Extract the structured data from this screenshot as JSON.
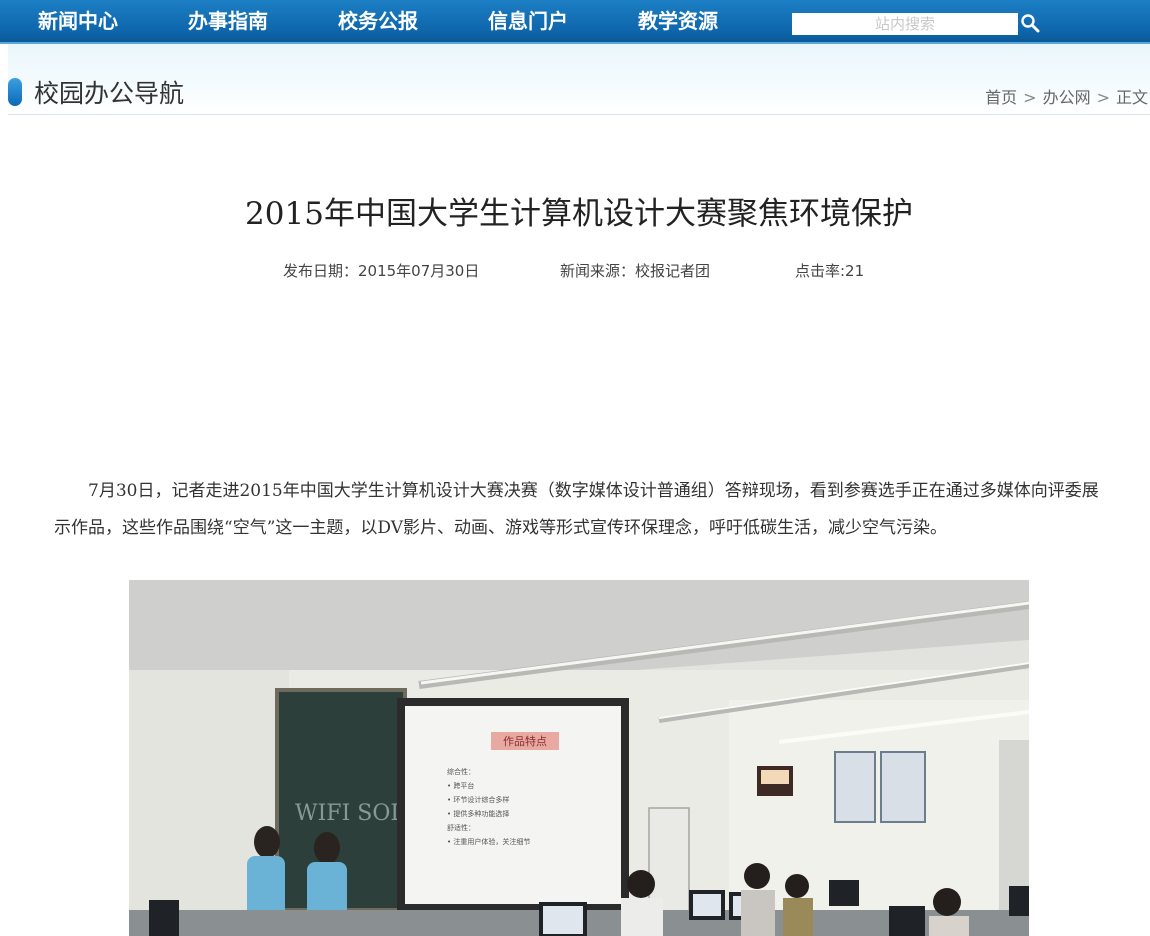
{
  "nav": {
    "items": [
      "新闻中心",
      "办事指南",
      "校务公报",
      "信息门户",
      "教学资源"
    ],
    "search_placeholder": "站内搜索"
  },
  "location": {
    "title": "校园办公导航",
    "breadcrumb": [
      "首页",
      "办公网",
      "正文"
    ],
    "separator": ">"
  },
  "article": {
    "title": "2015年中国大学生计算机设计大赛聚焦环境保护",
    "publish_date": "发布日期：2015年07月30日",
    "source": "新闻来源：校报记者团",
    "clicks": "点击率:21",
    "paragraph": "7月30日，记者走进2015年中国大学生计算机设计大赛决赛（数字媒体设计普通组）答辩现场，看到参赛选手正在通过多媒体向评委展示作品，这些作品围绕“空气”这一主题，以DV影片、动画、游戏等形式宣传环保理念，呼吁低碳生活，减少空气污染。"
  },
  "photo": {
    "slide_title": "作品特点",
    "slide_lines": [
      "综合性：",
      "• 跨平台",
      "• 环节设计综合多样",
      "• 提供多种功能选择",
      "舒适性：",
      "• 注重用户体验，关注细节"
    ],
    "board_text": "WIFI SOLO"
  },
  "colors": {
    "nav_bg": "#0f67ad",
    "accent": "#1d7fc4",
    "location_bg": "#eaf6fc"
  }
}
